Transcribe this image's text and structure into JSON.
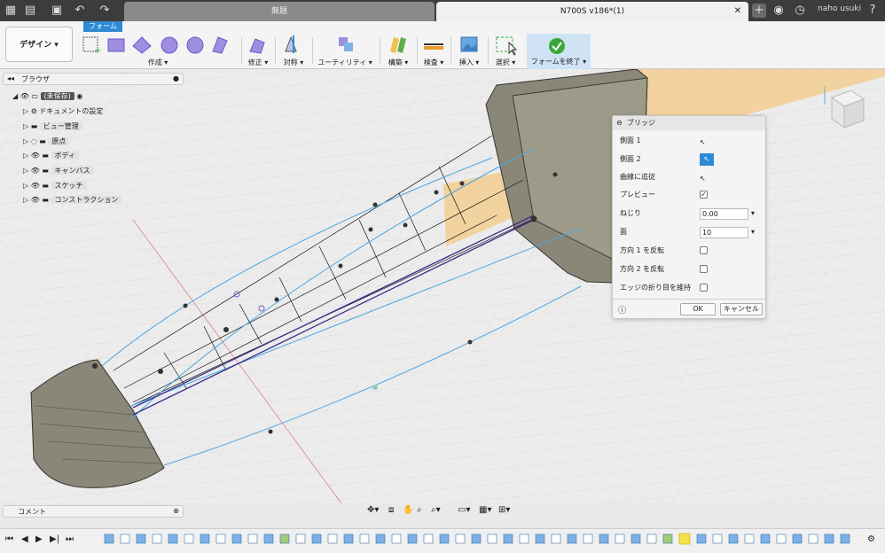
{
  "window": {
    "user": "naho usuki"
  },
  "tabs": [
    {
      "label": "無題",
      "active": false
    },
    {
      "label": "N700S v186*(1)",
      "active": true
    }
  ],
  "ribbon": {
    "design_label": "デザイン",
    "form_tab": "フォーム",
    "groups": {
      "create": "作成",
      "modify": "修正",
      "symmetry": "対称",
      "utility": "ユーティリティ",
      "construct": "構築",
      "inspect": "検査",
      "insert": "挿入",
      "select": "選択",
      "finish": "フォームを終了"
    }
  },
  "browser": {
    "title": "ブラウザ",
    "root": "(未保存)",
    "items": [
      "ドキュメントの設定",
      "ビュー管理",
      "原点",
      "ボディ",
      "キャンバス",
      "スケッチ",
      "コンストラクション"
    ]
  },
  "comment": {
    "label": "コメント"
  },
  "dialog": {
    "title": "ブリッジ",
    "side1": "側面 1",
    "side2": "側面 2",
    "follow_curve": "曲線に追従",
    "preview": "プレビュー",
    "twist": "ねじり",
    "twist_value": "0.00",
    "faces": "面",
    "faces_value": "10",
    "flip1": "方向 1 を反転",
    "flip2": "方向 2 を反転",
    "keep_crease": "エッジの折り目を維持",
    "ok": "OK",
    "cancel": "キャンセル"
  },
  "colors": {
    "accent": "#2f8ad6",
    "finish_green": "#3aa838",
    "body": "#8b8778",
    "highlight": "#f5c77e",
    "selection": "#2a6fd6"
  }
}
